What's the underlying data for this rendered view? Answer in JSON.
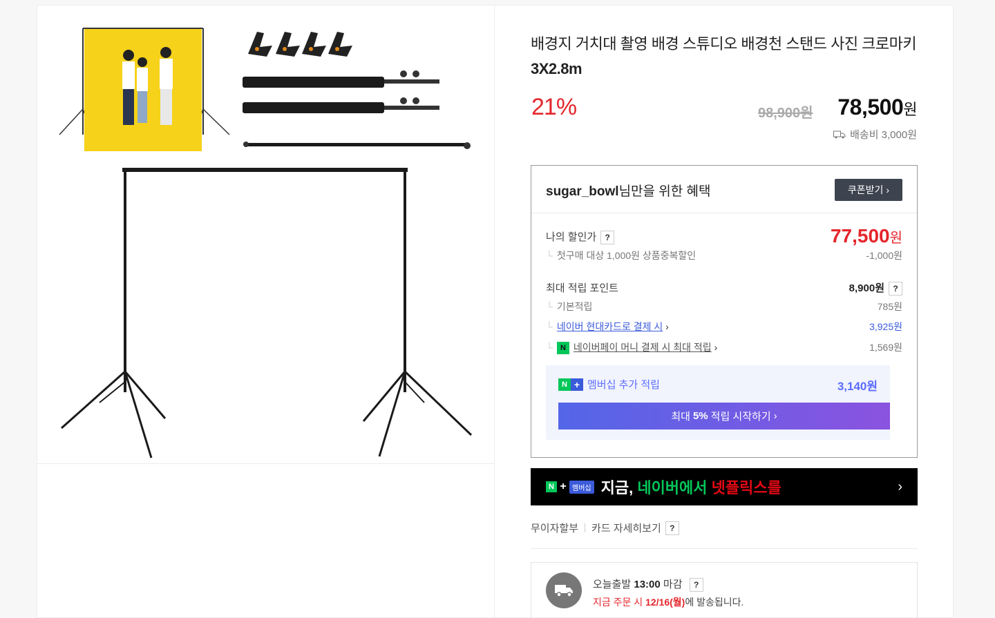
{
  "product": {
    "title_normal": "배경지 거치대 촬영 배경 스튜디오 배경천 스탠드 사진 크로마키",
    "title_bold": "3X2.8m",
    "discount": "21%",
    "original_price": "98,900원",
    "sale_price": "78,500",
    "sale_currency": "원",
    "shipping": "배송비 3,000원"
  },
  "benefit": {
    "user": "sugar_bowl",
    "title_suffix": "님만을 위한 혜택",
    "coupon_button": "쿠폰받기",
    "my_price_label": "나의 할인가",
    "my_price": "77,500",
    "my_price_currency": "원",
    "first_purchase": "첫구매 대상 1,000원 상품중복할인",
    "first_purchase_value": "-1,000원",
    "max_points_label": "최대 적립 포인트",
    "max_points_value": "8,900원",
    "base_points_label": "기본적립",
    "base_points_value": "785원",
    "hyundai_label": "네이버 현대카드로 결제 시",
    "hyundai_value": "3,925원",
    "npay_label": "네이버페이 머니 결제 시 최대 적립",
    "npay_value": "1,569원",
    "membership_label": "멤버십 추가 적립",
    "membership_value": "3,140원",
    "membership_button_pre": "최대",
    "membership_button_bold": "5%",
    "membership_button_post": "적립 시작하기"
  },
  "banner": {
    "badge_text": "멤버십",
    "text_white": "지금,",
    "text_green": "네이버에서",
    "text_red": "넷플릭스를"
  },
  "pay_links": {
    "installment": "무이자할부",
    "card_detail": "카드 자세히보기"
  },
  "delivery": {
    "today_label": "오늘출발",
    "cutoff": "13:00",
    "cutoff_suffix": "마감",
    "order_now": "지금 주문 시",
    "date": "12/16(월)",
    "date_suffix": "에 발송됩니다."
  },
  "colors": {
    "accent_red": "#e4262c",
    "naver_green": "#03c75a",
    "link_blue": "#3b5bdb",
    "backdrop_yellow": "#f6d21a"
  }
}
